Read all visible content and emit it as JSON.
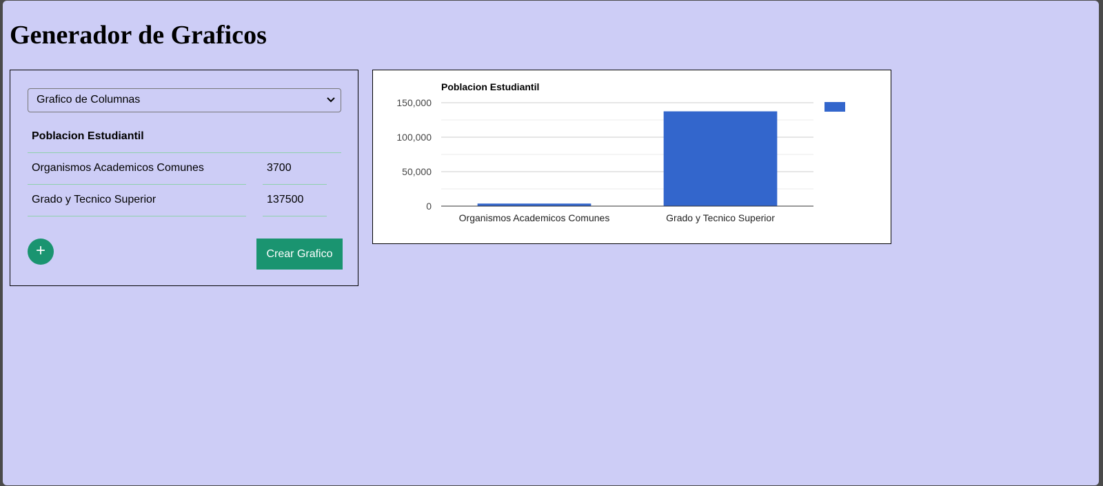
{
  "page": {
    "title": "Generador de Graficos"
  },
  "form": {
    "chart_type_selected": "Grafico de Columnas",
    "chart_title": "Poblacion Estudiantil",
    "rows": [
      {
        "label": "Organismos Academicos Comunes",
        "value": "3700"
      },
      {
        "label": "Grado y Tecnico Superior",
        "value": "137500"
      }
    ],
    "add_button_label": "+",
    "create_button_label": "Crear Grafico"
  },
  "colors": {
    "page_background": "#cdcdf6",
    "button_green": "#1a9470",
    "bar_blue": "#3366cc"
  },
  "icons": {
    "select_arrow": "chevron-down-icon",
    "add": "plus-icon"
  },
  "chart_data": {
    "type": "bar",
    "title": "Poblacion Estudiantil",
    "categories": [
      "Organismos Academicos Comunes",
      "Grado y Tecnico Superior"
    ],
    "values": [
      3700,
      137500
    ],
    "y_ticks": [
      "0",
      "50,000",
      "100,000",
      "150,000"
    ],
    "ylim": [
      0,
      150000
    ],
    "xlabel": "",
    "ylabel": "",
    "grid": true,
    "legend": "right",
    "series": [
      {
        "values": [
          3700,
          137500
        ],
        "color": "#3366cc"
      }
    ]
  }
}
